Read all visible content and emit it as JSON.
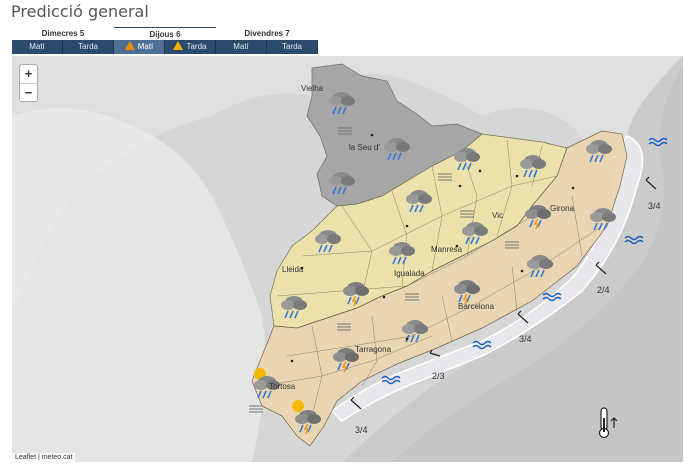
{
  "title": "Predicció general",
  "days": [
    {
      "label": "Dimecres 5",
      "morning": "Matí",
      "afternoon": "Tarda"
    },
    {
      "label": "Dijous 6",
      "morning": "Matí",
      "afternoon": "Tarda"
    },
    {
      "label": "Divendres 7",
      "morning": "Matí",
      "afternoon": "Tarda"
    }
  ],
  "zoom": {
    "in": "+",
    "out": "−"
  },
  "attribution": "Leaflet | meteo.cat",
  "cities": [
    "Vielha",
    "la Seu d'",
    "Lleida",
    "Manresa",
    "Igualada",
    "Vic",
    "Girona",
    "Barcelona",
    "Tarragona",
    "Tortosa"
  ],
  "sea_states": [
    "3/4",
    "2/4",
    "3/4",
    "2/3",
    "3/4"
  ],
  "colors": {
    "accent": "#2c4a6b",
    "warning_yellow": "#f0b400",
    "warning_orange": "#f08a00",
    "alert_yellow": "#efe2a8",
    "alert_orange": "#ecd5b0"
  }
}
